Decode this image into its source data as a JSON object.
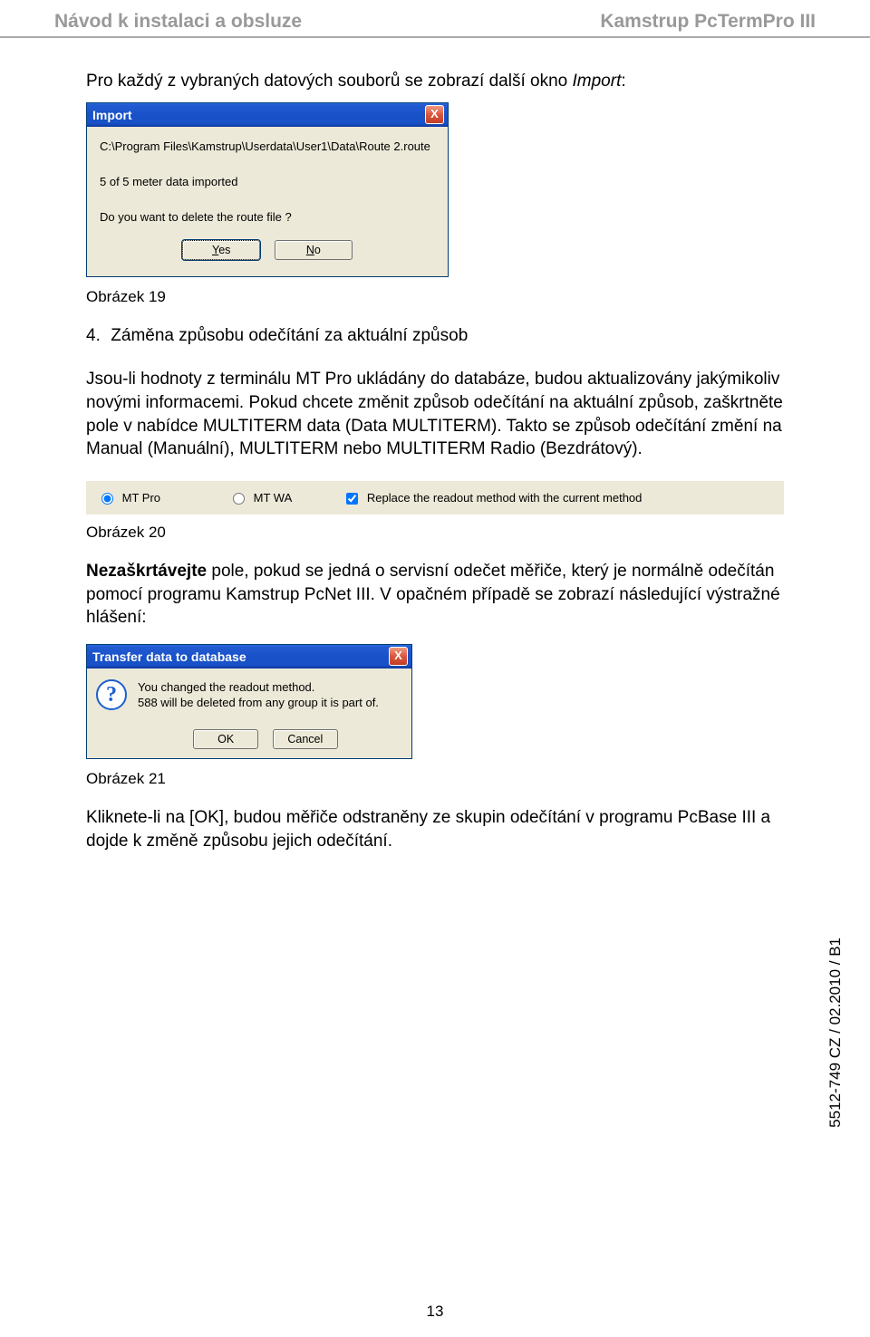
{
  "header": {
    "left": "Návod k instalaci a obsluze",
    "right": "Kamstrup PcTermPro III"
  },
  "intro": {
    "prefix": "Pro každý z vybraných datových souborů se zobrazí další okno ",
    "italic": "Import",
    "suffix": ":"
  },
  "dialog1": {
    "title": "Import",
    "close": "X",
    "path": "C:\\Program Files\\Kamstrup\\Userdata\\User1\\Data\\Route 2.route",
    "status": "5 of 5 meter data imported",
    "question": "Do you want to delete the route file ?",
    "yes_prefix": "Y",
    "yes_rest": "es",
    "no_prefix": "N",
    "no_rest": "o"
  },
  "fig19": "Obrázek 19",
  "section4": {
    "num": "4.",
    "title": "Záměna způsobu odečítání za aktuální způsob"
  },
  "para2": "Jsou-li hodnoty z terminálu MT Pro ukládány do databáze, budou aktualizovány jakýmikoliv novými informacemi. Pokud chcete změnit způsob odečítání na aktuální způsob, zaškrtněte pole v nabídce MULTITERM data (Data MULTITERM). Takto se způsob odečítání změní na Manual (Manuální), MULTITERM nebo MULTITERM Radio (Bezdrátový).",
  "options": {
    "radio1": "MT Pro",
    "radio2": "MT WA",
    "checkbox": "Replace the readout method with the current method"
  },
  "fig20": "Obrázek 20",
  "para3_bold": "Nezaškrtávejte",
  "para3_rest": " pole, pokud se jedná o servisní odečet měřiče, který je normálně odečítán pomocí programu Kamstrup PcNet III. V opačném případě se zobrazí následující výstražné hlášení:",
  "dialog2": {
    "title": "Transfer data to database",
    "close": "X",
    "line1": "You changed the readout method.",
    "line2": "588 will be deleted from any group it is part of.",
    "ok": "OK",
    "cancel": "Cancel"
  },
  "fig21": "Obrázek 21",
  "para4": "Kliknete-li na [OK], budou měřiče odstraněny ze skupin odečítání v programu PcBase III a dojde k změně způsobu jejich odečítání.",
  "side": "5512-749 CZ / 02.2010 / B1",
  "pagenum": "13"
}
